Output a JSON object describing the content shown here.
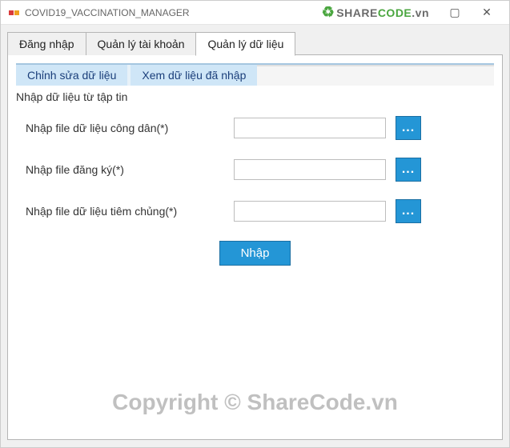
{
  "window": {
    "title": "COVID19_VACCINATION_MANAGER",
    "brand_prefix": "SHARE",
    "brand_suffix": "CODE",
    "brand_domain": ".vn",
    "close_glyph": "✕",
    "max_glyph": "▢"
  },
  "tabs": {
    "login": "Đăng nhập",
    "accounts": "Quản lý tài khoản",
    "data": "Quản lý dữ liệu"
  },
  "subtabs": {
    "edit": "Chỉnh sửa dữ liệu",
    "view": "Xem dữ liệu đã nhập"
  },
  "section_label": "Nhập dữ liệu từ tập tin",
  "fields": {
    "citizen": {
      "label": "Nhập file dữ liệu công dân(*)",
      "value": ""
    },
    "register": {
      "label": "Nhập file đăng ký(*)",
      "value": ""
    },
    "vaccination": {
      "label": "Nhập file dữ liệu tiêm chủng(*)",
      "value": ""
    }
  },
  "browse_label": "...",
  "submit_label": "Nhập",
  "watermarks": {
    "mid": "ShareCode.vn",
    "bottom": "Copyright © ShareCode.vn"
  },
  "colors": {
    "accent": "#2496d6",
    "accent_border": "#1b6fa3",
    "subtab_bg": "#cfe6f7",
    "brand_green": "#4aa63f"
  }
}
